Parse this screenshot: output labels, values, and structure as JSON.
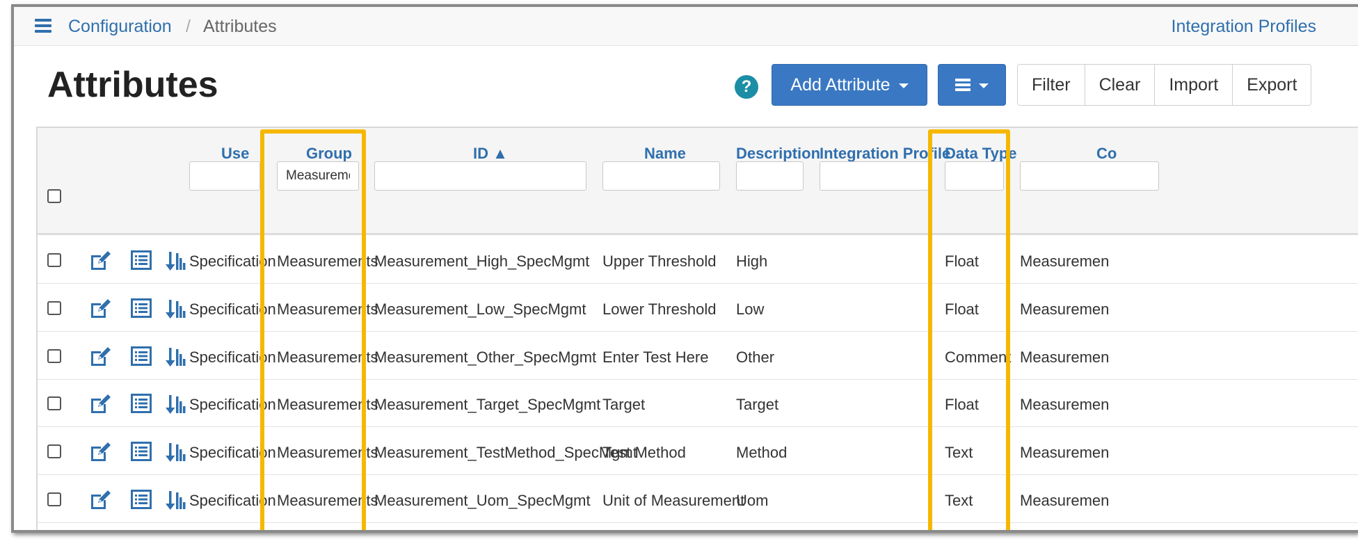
{
  "breadcrumb": {
    "root": "Configuration",
    "separator": "/",
    "current": "Attributes"
  },
  "header_link": "Integration Profiles",
  "page_title": "Attributes",
  "help_glyph": "?",
  "toolbar": {
    "add_label": "Add Attribute",
    "filter_label": "Filter",
    "clear_label": "Clear",
    "import_label": "Import",
    "export_label": "Export"
  },
  "columns": {
    "use": "Use",
    "group": "Group",
    "id": "ID ▲",
    "name": "Name",
    "description": "Description",
    "integration_profile": "Integration Profile",
    "data_type": "Data Type",
    "next": "Co"
  },
  "filters": {
    "group": "Measurements",
    "use": "",
    "id": "",
    "name": "",
    "description": "",
    "integration_profile": "",
    "data_type": ""
  },
  "rows": [
    {
      "use": "Specification",
      "group": "Measurements",
      "id": "Measurement_High_SpecMgmt",
      "name": "Upper Threshold",
      "description": "High",
      "data_type": "Float",
      "next": "Measuremen"
    },
    {
      "use": "Specification",
      "group": "Measurements",
      "id": "Measurement_Low_SpecMgmt",
      "name": "Lower Threshold",
      "description": "Low",
      "data_type": "Float",
      "next": "Measuremen"
    },
    {
      "use": "Specification",
      "group": "Measurements",
      "id": "Measurement_Other_SpecMgmt",
      "name": "Enter Test Here",
      "description": "Other",
      "data_type": "Comment",
      "next": "Measuremen"
    },
    {
      "use": "Specification",
      "group": "Measurements",
      "id": "Measurement_Target_SpecMgmt",
      "name": "Target",
      "description": "Target",
      "data_type": "Float",
      "next": "Measuremen"
    },
    {
      "use": "Specification",
      "group": "Measurements",
      "id": "Measurement_TestMethod_SpecMgmt",
      "name": "Test Method",
      "description": "Method",
      "data_type": "Text",
      "next": "Measuremen"
    },
    {
      "use": "Specification",
      "group": "Measurements",
      "id": "Measurement_Uom_SpecMgmt",
      "name": "Unit of Measurement",
      "description": "Uom",
      "data_type": "Text",
      "next": "Measuremen"
    }
  ],
  "colors": {
    "accent": "#3a78c3",
    "link": "#2f6fad",
    "highlight": "#f5b800",
    "help": "#1b8ea6"
  },
  "icons": {
    "menu": "hamburger-icon",
    "help": "help-icon",
    "edit": "edit-icon",
    "details": "list-details-icon",
    "sort": "sort-order-icon"
  }
}
